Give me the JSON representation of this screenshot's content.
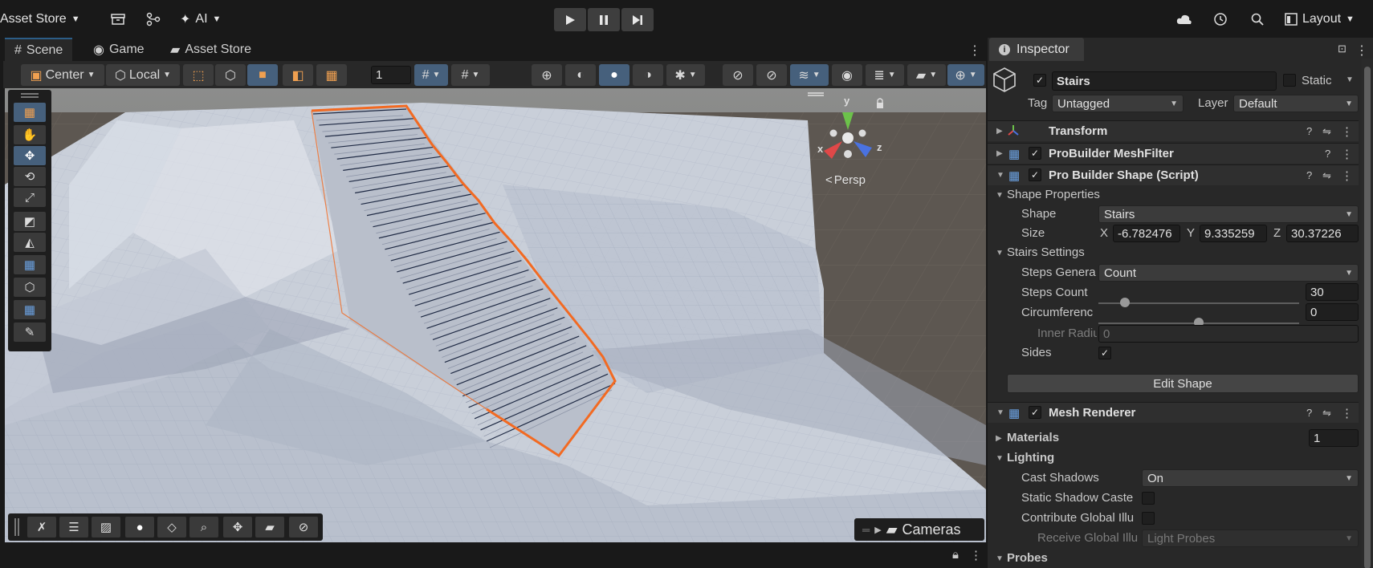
{
  "topbar": {
    "asset_store": "Asset Store",
    "ai": "AI",
    "layout": "Layout"
  },
  "scene_tabs": [
    "Scene",
    "Game",
    "Asset Store"
  ],
  "scene_toolbar": {
    "pivot": "Center",
    "space": "Local",
    "grid_size": "1"
  },
  "viewport": {
    "persp_label": "Persp",
    "axis_x": "x",
    "axis_y": "y",
    "axis_z": "z",
    "cameras_label": "Cameras"
  },
  "inspector": {
    "tab": "Inspector",
    "object_name": "Stairs",
    "static_label": "Static",
    "tag_label": "Tag",
    "tag_value": "Untagged",
    "layer_label": "Layer",
    "layer_value": "Default",
    "components": {
      "transform": "Transform",
      "meshfilter": "ProBuilder MeshFilter",
      "shape": "Pro Builder Shape (Script)",
      "renderer": "Mesh Renderer"
    },
    "shape_props": {
      "header": "Shape Properties",
      "shape_label": "Shape",
      "shape_value": "Stairs",
      "size_label": "Size",
      "x": "-6.782476",
      "y": "9.335259",
      "z": "30.37226"
    },
    "stairs": {
      "header": "Stairs Settings",
      "gen_label": "Steps Genera",
      "gen_value": "Count",
      "count_label": "Steps Count",
      "count_value": "30",
      "count_fraction": 0.13,
      "circ_label": "Circumferenc",
      "circ_value": "0",
      "circ_fraction": 0.5,
      "inner_label": "Inner Radiu",
      "inner_value": "0",
      "sides_label": "Sides",
      "edit_button": "Edit Shape"
    },
    "renderer": {
      "materials_label": "Materials",
      "materials_value": "1",
      "lighting_label": "Lighting",
      "cast_label": "Cast Shadows",
      "cast_value": "On",
      "static_caster_label": "Static Shadow Caste",
      "contribute_label": "Contribute Global Illu",
      "receive_label": "Receive Global Illu",
      "receive_value": "Light Probes",
      "probes_label": "Probes"
    }
  },
  "colors": {
    "accent": "#46607c",
    "selection": "#f26a22",
    "background": "#191919"
  }
}
